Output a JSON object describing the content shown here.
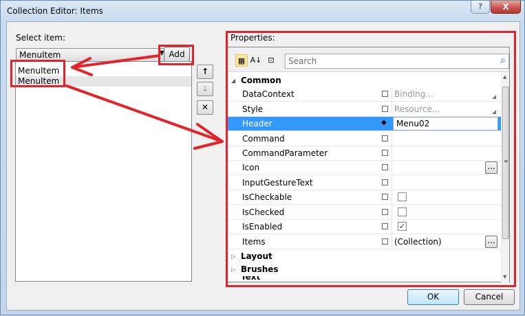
{
  "window": {
    "title": "Collection Editor: Items",
    "help_label": "?",
    "close_label": "X"
  },
  "left": {
    "select_label": "Select item:",
    "combo_value": "MenuItem",
    "add_label": "Add",
    "items": [
      "MenuItem",
      "MenuItem"
    ],
    "move_up_label": "↑",
    "move_down_label": "↓",
    "remove_label": "✕"
  },
  "properties": {
    "label": "Properties:",
    "search_placeholder": "Search",
    "categories": [
      "Common",
      "Layout",
      "Brushes",
      "Text"
    ],
    "rows": [
      {
        "name": "DataContext",
        "value": "Binding...",
        "hint": true
      },
      {
        "name": "Style",
        "value": "Resource...",
        "hint": true
      },
      {
        "name": "Header",
        "value": "Menu02",
        "hint": false
      },
      {
        "name": "Command",
        "value": "",
        "hint": false
      },
      {
        "name": "CommandParameter",
        "value": "",
        "hint": false
      },
      {
        "name": "Icon",
        "value": "",
        "hint": false
      },
      {
        "name": "InputGestureText",
        "value": "",
        "hint": false
      },
      {
        "name": "IsCheckable",
        "value": "",
        "hint": false
      },
      {
        "name": "IsChecked",
        "value": "",
        "hint": false
      },
      {
        "name": "IsEnabled",
        "value": "",
        "hint": false
      },
      {
        "name": "Items",
        "value": "(Collection)",
        "hint": false
      }
    ],
    "ellipsis_label": "...",
    "is_enabled_checked": true
  },
  "footer": {
    "ok_label": "OK",
    "cancel_label": "Cancel"
  },
  "colors": {
    "annotation_red": "#e3222a",
    "selection_blue": "#3399ff"
  }
}
